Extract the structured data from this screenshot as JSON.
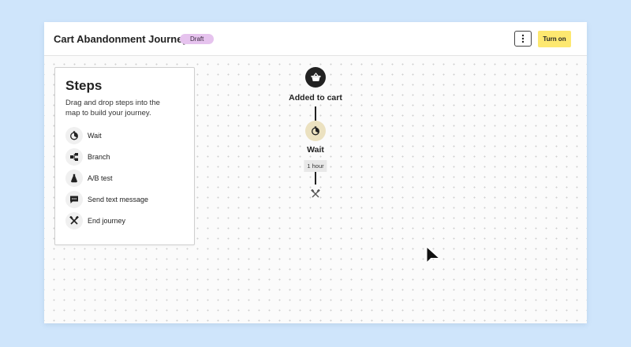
{
  "header": {
    "title": "Cart Abandonment Journey",
    "status_badge": "Draft",
    "turn_on_label": "Turn on",
    "menu_icon": "more-vertical-icon"
  },
  "steps_panel": {
    "title": "Steps",
    "description": "Drag and drop steps into the map to build your journey.",
    "items": [
      {
        "label": "Wait",
        "icon": "timer-icon"
      },
      {
        "label": "Branch",
        "icon": "branch-icon"
      },
      {
        "label": "A/B test",
        "icon": "flask-icon"
      },
      {
        "label": "Send text message",
        "icon": "message-icon"
      },
      {
        "label": "End journey",
        "icon": "crossed-tools-icon"
      }
    ]
  },
  "journey": {
    "trigger": {
      "label": "Added to cart",
      "icon": "basket-icon"
    },
    "wait": {
      "label": "Wait",
      "duration": "1 hour",
      "icon": "timer-icon"
    },
    "end_icon": "crossed-tools-icon"
  },
  "colors": {
    "page_background": "#cfe5fb",
    "badge": "#e6c3ee",
    "primary_button": "#fde870",
    "trigger_node": "#222222",
    "wait_node": "#ebe1c0"
  }
}
